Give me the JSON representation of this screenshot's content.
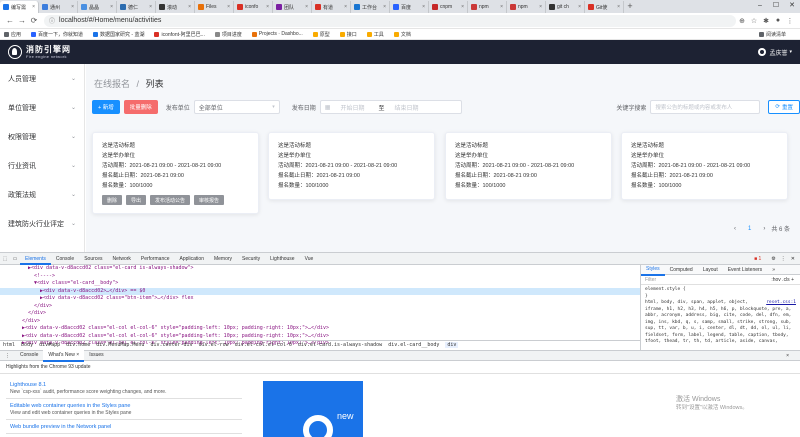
{
  "browser": {
    "tabs": [
      {
        "label": "编写需",
        "color": "#1a73e8",
        "active": true
      },
      {
        "label": "通州",
        "color": "#3b7ddd"
      },
      {
        "label": "晶晶",
        "color": "#4a90e2"
      },
      {
        "label": "德仁",
        "color": "#2b6cb0"
      },
      {
        "label": "滚动",
        "color": "#333333"
      },
      {
        "label": "Files",
        "color": "#e8710a"
      },
      {
        "label": "iconfo",
        "color": "#d93025"
      },
      {
        "label": "团队",
        "color": "#7b1fa2"
      },
      {
        "label": "有道",
        "color": "#d93025"
      },
      {
        "label": "工作台",
        "color": "#1976d2"
      },
      {
        "label": "百度",
        "color": "#2962ff"
      },
      {
        "label": "cnpm",
        "color": "#c62828"
      },
      {
        "label": "npm",
        "color": "#cb3837"
      },
      {
        "label": "npm",
        "color": "#cb3837"
      },
      {
        "label": "git ch",
        "color": "#333333"
      },
      {
        "label": "Git使",
        "color": "#d93025"
      }
    ],
    "url": "localhost/#/Home/menu/activities",
    "bookmarks": [
      {
        "label": "应用",
        "color": "#5f6368"
      },
      {
        "label": "百度一下，你就知道",
        "color": "#2962ff"
      },
      {
        "label": "数据国家研究 - 蓝湖",
        "color": "#1a73e8"
      },
      {
        "label": "iconfont-阿里巴巴...",
        "color": "#d93025"
      },
      {
        "label": "项目进度",
        "color": "#888888"
      },
      {
        "label": "Projects · Dashbo...",
        "color": "#e8710a"
      },
      {
        "label": "原型",
        "color": "#f9ab00"
      },
      {
        "label": "接口",
        "color": "#f9ab00"
      },
      {
        "label": "工具",
        "color": "#f9ab00"
      },
      {
        "label": "文档",
        "color": "#f9ab00"
      }
    ],
    "reading_list": "阅读清单"
  },
  "header": {
    "brand_cn": "消防引擎网",
    "brand_en": "Fire engine network",
    "user": "孟庆誉"
  },
  "sidebar": {
    "items": [
      "人员管理",
      "单位管理",
      "权限管理",
      "行业资讯",
      "政策法规",
      "建筑防火行业评定"
    ]
  },
  "main": {
    "breadcrumb_parent": "在线报名",
    "breadcrumb_sep": "/",
    "breadcrumb_current": "列表",
    "add_button": "+ 新增",
    "batch_delete_button": "批量删除",
    "unit_label": "发布单位",
    "unit_value": "全部单位",
    "date_label": "发布日期",
    "date_start": "开始日期",
    "date_to": "至",
    "date_end": "结束日期",
    "keyword_label": "关键字搜索",
    "keyword_placeholder": "搜索公告的标题或内容或发布人",
    "reset_button": "重置",
    "cards": [
      {
        "title": "这是活动标题",
        "unit": "这是举办单位",
        "period": "活动周期：2021-08-21 09:00 - 2021-08-21 09:00",
        "deadline": "报名截止日期：2021-08-21 09:00",
        "count": "报名数量：100/1000",
        "buttons": [
          "删除",
          "导出",
          "发布活动公告",
          "审核报告"
        ]
      },
      {
        "title": "这是活动标题",
        "unit": "这是举办单位",
        "period": "活动周期：2021-08-21 09:00 - 2021-08-21 09:00",
        "deadline": "报名截止日期：2021-08-21 09:00",
        "count": "报名数量：100/1000"
      },
      {
        "title": "这是活动标题",
        "unit": "这是举办单位",
        "period": "活动周期：2021-08-21 09:00 - 2021-08-21 09:00",
        "deadline": "报名截止日期：2021-08-21 09:00",
        "count": "报名数量：100/1000"
      },
      {
        "title": "这是活动标题",
        "unit": "这是举办单位",
        "period": "活动周期：2021-08-21 09:00 - 2021-08-21 09:00",
        "deadline": "报名截止日期：2021-08-21 09:00",
        "count": "报名数量：100/1000"
      }
    ],
    "pager": {
      "prev": "‹",
      "page": "1",
      "next": "›",
      "total": "共 6 条"
    }
  },
  "devtools": {
    "tabs": [
      "Elements",
      "Console",
      "Sources",
      "Network",
      "Performance",
      "Application",
      "Memory",
      "Security",
      "Lighthouse",
      "Vue"
    ],
    "active_tab": "Elements",
    "errors": "1",
    "dom_lines": [
      "▶<div data-v-d8accd02 class=\"el-card is-always-shadow\">",
      "<!---->",
      "▼<div class=\"el-card__body\">",
      "▶<div data-v-d8accd02>…</div> == $0",
      "▶<div data-v-d8accd02 class=\"btn-item\">…</div> flex",
      "</div>",
      "</div>",
      "</div>",
      "▶<div data-v-d8accd02 class=\"el-col el-col-6\" style=\"padding-left: 10px; padding-right: 10px;\">…</div>",
      "▶<div data-v-d8accd02 class=\"el-col el-col-6\" style=\"padding-left: 10px; padding-right: 10px;\">…</div>",
      "▶<div data-v-d8accd02 class=\"el-col el-col-6\" style=\"padding-left: 10px; padding-right: 10px;\">…</div>"
    ],
    "crumbs": [
      "html",
      "body",
      "div#app",
      "div.home",
      "div.MenuMap.Menu",
      "div.center-div",
      "div.el-row",
      "div.el-col.el-col-6",
      "div.el-card.is-always-shadow",
      "div.el-card__body",
      "div"
    ],
    "style_tabs": [
      "Styles",
      "Computed",
      "Layout",
      "Event Listeners",
      "»"
    ],
    "filter_placeholder": "Filter",
    "filter_right": ":hov .cls +",
    "rule_selector": "element.style {",
    "rule_close": "}",
    "reset_source": "reset.css:1",
    "rule_text": "html, body, div, span, applet, object, iframe, h1, h2, h3, h4, h5, h6, p, blockquote, pre, a, abbr, acronym, address, big, cite, code, del, dfn, em, img, ins, kbd, q, s, samp, small, strike, strong, sub, sup, tt, var, b, u, i, center, dl, dt, dd, ol, ul, li, fieldset, form, label, legend, table, caption, tbody, tfoot, thead, tr, th, td, article, aside, canvas,",
    "drawer_tabs": [
      "Console",
      "What's New ×",
      "Issues"
    ],
    "drawer_close": "×",
    "highlight": "Highlights from the Chrome 93 update",
    "news": [
      {
        "title": "Lighthouse 8.1",
        "desc": "New `csp-xss` audit, performance score weighting changes, and more."
      },
      {
        "title": "Editable web container queries in the Styles pane",
        "desc": "View and edit web container queries in the Styles pane"
      },
      {
        "title": "Web bundle preview in the Network panel",
        "desc": ""
      }
    ],
    "promo_text": "new",
    "windows_watermark_1": "激活 Windows",
    "windows_watermark_2": "转到\"设置\"以激活 Windows。"
  }
}
